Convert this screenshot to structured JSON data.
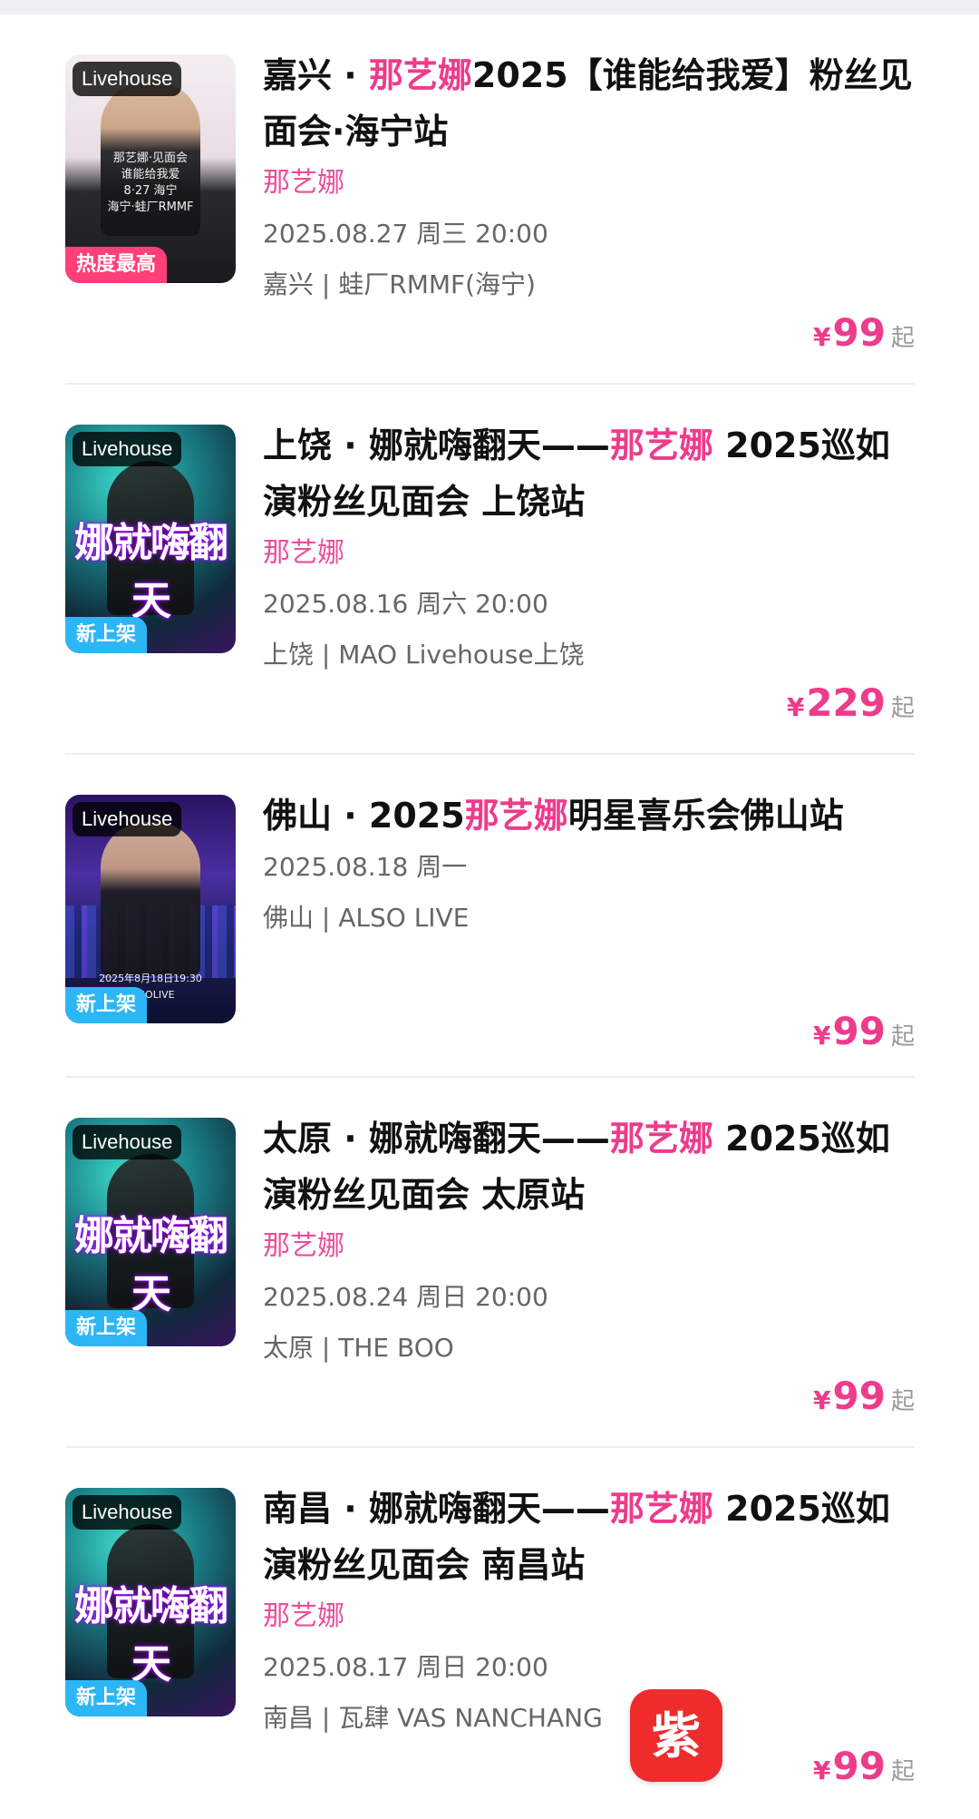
{
  "events": [
    {
      "badge_top": "Livehouse",
      "badge_bottom": "热度最高",
      "badge_type": "hot",
      "poster_style": "light",
      "poster_caption": "那艺娜·见面会\n谁能给我爱\n8·27 海宁\n海宁·蛙厂RMMF",
      "title_pre": "嘉兴 · ",
      "title_hl": "那艺娜",
      "title_post": "2025【谁能给我爱】粉丝见面会·海宁站",
      "artist": "那艺娜",
      "datetime": "2025.08.27 周三 20:00",
      "venue": "嘉兴 | 蛙厂RMMF(海宁)",
      "price_symbol": "¥",
      "price": "99",
      "price_suffix": "起"
    },
    {
      "badge_top": "Livehouse",
      "badge_bottom": "新上架",
      "badge_type": "new",
      "poster_style": "teal",
      "poster_art": "娜就嗨翻天",
      "title_pre": "上饶 · 娜就嗨翻天——",
      "title_hl": "那艺娜",
      "title_post": " 2025巡如演粉丝见面会 上饶站",
      "artist": "那艺娜",
      "datetime": "2025.08.16 周六 20:00",
      "venue": "上饶 | MAO Livehouse上饶",
      "price_symbol": "¥",
      "price": "229",
      "price_suffix": "起"
    },
    {
      "badge_top": "Livehouse",
      "badge_bottom": "新上架",
      "badge_type": "new",
      "poster_style": "purple",
      "poster_caption": "2025年8月18日19:30 ALSOLIVE",
      "title_pre": "佛山 · 2025",
      "title_hl": "那艺娜",
      "title_post": "明星喜乐会佛山站",
      "artist": "",
      "datetime": "2025.08.18 周一",
      "venue": "佛山 | ALSO LIVE",
      "price_symbol": "¥",
      "price": "99",
      "price_suffix": "起"
    },
    {
      "badge_top": "Livehouse",
      "badge_bottom": "新上架",
      "badge_type": "new",
      "poster_style": "teal",
      "poster_art": "娜就嗨翻天",
      "title_pre": "太原 · 娜就嗨翻天——",
      "title_hl": "那艺娜",
      "title_post": " 2025巡如演粉丝见面会 太原站",
      "artist": "那艺娜",
      "datetime": "2025.08.24 周日 20:00",
      "venue": "太原 | THE BOO",
      "price_symbol": "¥",
      "price": "99",
      "price_suffix": "起"
    },
    {
      "badge_top": "Livehouse",
      "badge_bottom": "新上架",
      "badge_type": "new",
      "poster_style": "teal",
      "poster_art": "娜就嗨翻天",
      "title_pre": "南昌 · 娜就嗨翻天——",
      "title_hl": "那艺娜",
      "title_post": " 2025巡如演粉丝见面会 南昌站",
      "artist": "那艺娜",
      "datetime": "2025.08.17 周日 20:00",
      "venue": "南昌 | 瓦肆 VAS NANCHANG",
      "price_symbol": "¥",
      "price": "99",
      "price_suffix": "起"
    }
  ],
  "app_logo_text": "紫牛"
}
